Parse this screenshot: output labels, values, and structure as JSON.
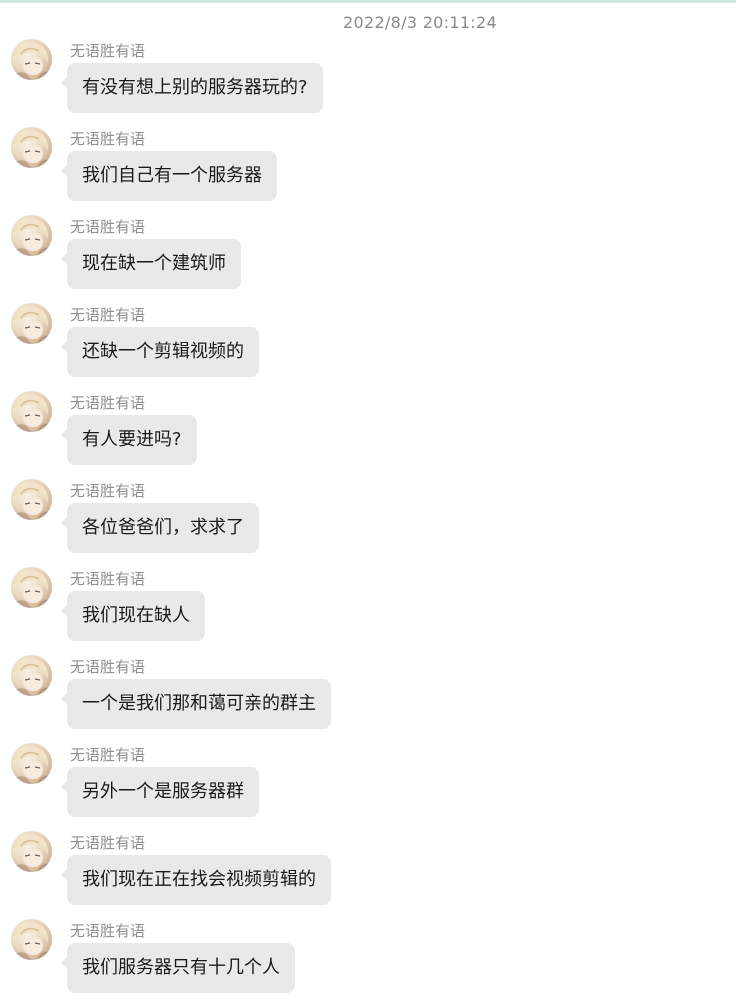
{
  "timestamp": "2022/8/3 20:11:24",
  "sender_name": "无语胜有语",
  "messages": [
    {
      "text": "有没有想上别的服务器玩的?"
    },
    {
      "text": "我们自己有一个服务器"
    },
    {
      "text": "现在缺一个建筑师"
    },
    {
      "text": "还缺一个剪辑视频的"
    },
    {
      "text": "有人要进吗?"
    },
    {
      "text": "各位爸爸们，求求了"
    },
    {
      "text": "我们现在缺人"
    },
    {
      "text": "一个是我们那和蔼可亲的群主"
    },
    {
      "text": "另外一个是服务器群"
    },
    {
      "text": "我们现在正在找会视频剪辑的"
    },
    {
      "text": "我们服务器只有十几个人"
    }
  ],
  "colors": {
    "bubble": "#e9e9e9",
    "sender_text": "#8f8f8f",
    "timestamp_text": "#8a8a8a",
    "top_border": "#cfe9e3"
  },
  "icons": {
    "avatar": "anime-avatar-icon"
  }
}
